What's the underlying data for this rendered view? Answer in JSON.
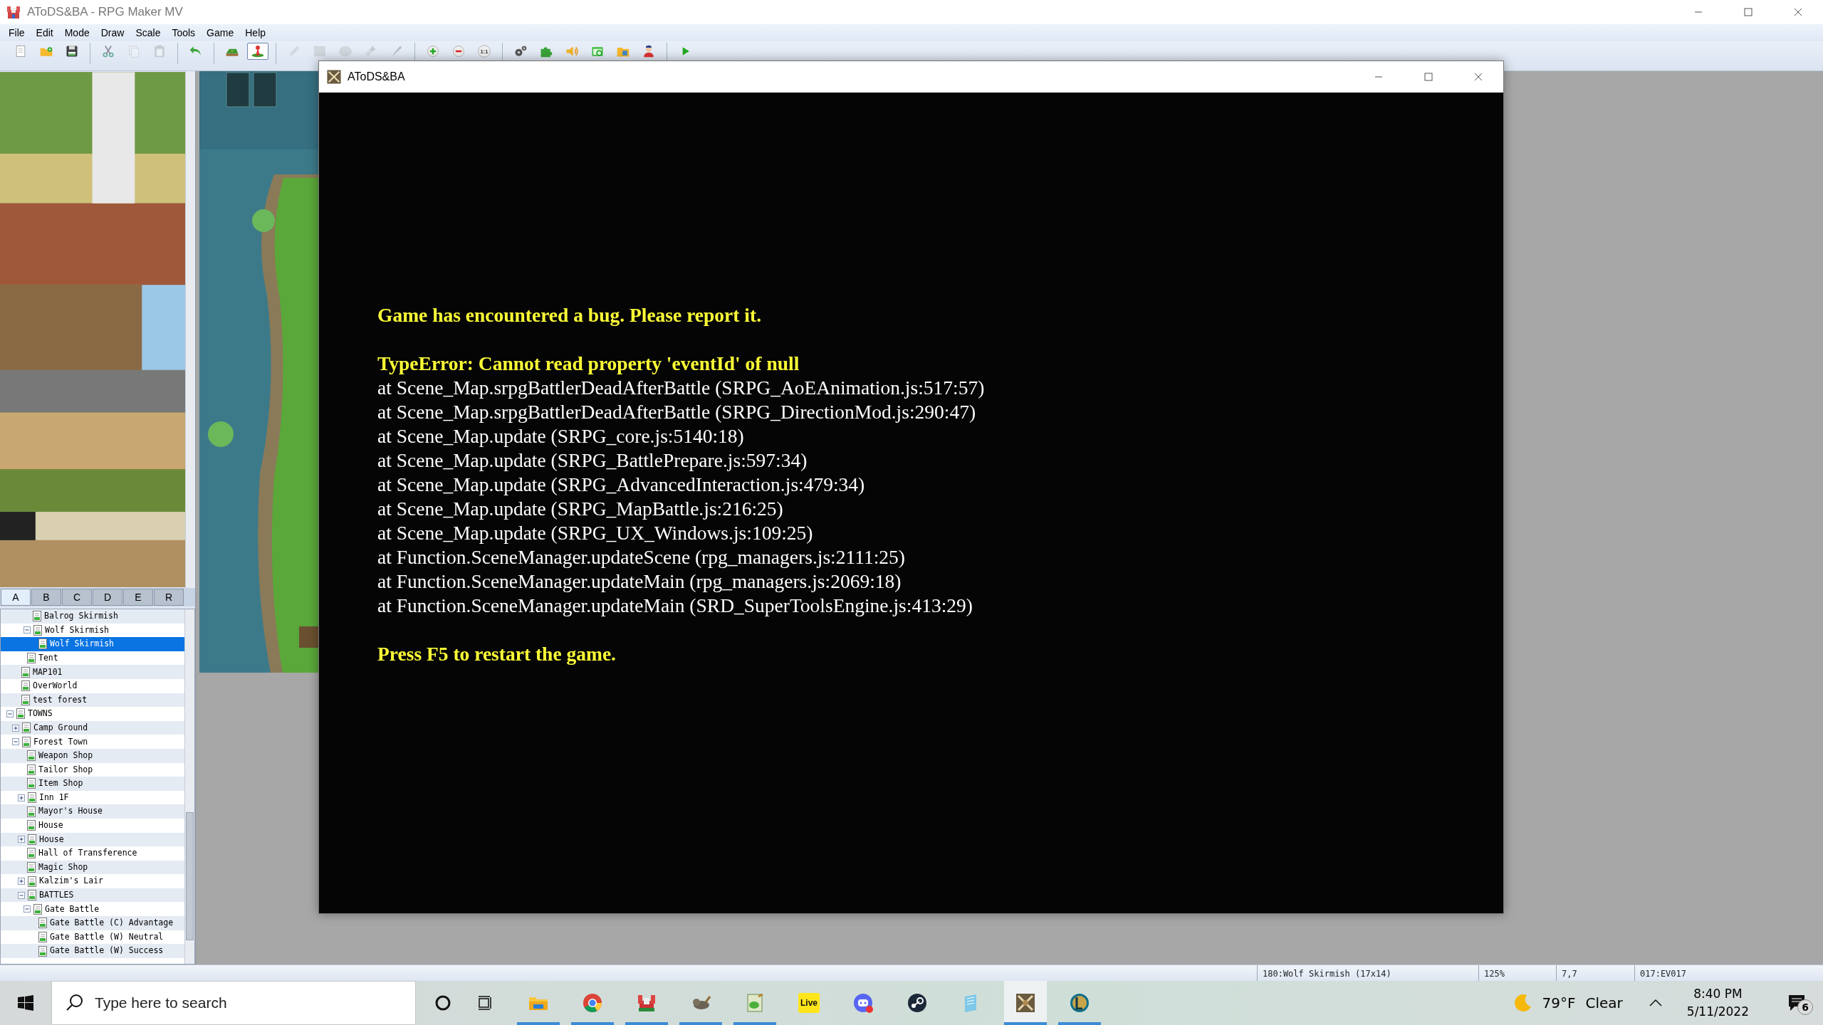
{
  "window": {
    "title": "AToDS&BA - RPG Maker MV"
  },
  "menu": [
    "File",
    "Edit",
    "Mode",
    "Draw",
    "Scale",
    "Tools",
    "Game",
    "Help"
  ],
  "toolbar": [
    {
      "kind": "new",
      "selected": false,
      "disabled": false
    },
    {
      "kind": "open",
      "selected": false,
      "disabled": false
    },
    {
      "kind": "save",
      "selected": false,
      "disabled": false
    },
    {
      "kind": "cut",
      "selected": false,
      "disabled": false
    },
    {
      "kind": "copy",
      "selected": false,
      "disabled": true
    },
    {
      "kind": "paste",
      "selected": false,
      "disabled": true
    },
    {
      "kind": "undo",
      "selected": false,
      "disabled": false
    },
    {
      "kind": "map",
      "selected": false,
      "disabled": false
    },
    {
      "kind": "event",
      "selected": true,
      "disabled": false
    },
    {
      "kind": "pencil",
      "selected": false,
      "disabled": true
    },
    {
      "kind": "rectangle",
      "selected": false,
      "disabled": true
    },
    {
      "kind": "ellipse",
      "selected": false,
      "disabled": true
    },
    {
      "kind": "fill",
      "selected": false,
      "disabled": true
    },
    {
      "kind": "shadow",
      "selected": false,
      "disabled": true
    },
    {
      "kind": "zoom-in",
      "selected": false,
      "disabled": false
    },
    {
      "kind": "zoom-out",
      "selected": false,
      "disabled": false
    },
    {
      "kind": "zoom-reset",
      "label": "1:1",
      "selected": false,
      "disabled": false
    },
    {
      "kind": "database",
      "selected": false,
      "disabled": false
    },
    {
      "kind": "plugins",
      "selected": false,
      "disabled": false
    },
    {
      "kind": "sound",
      "selected": false,
      "disabled": false
    },
    {
      "kind": "search",
      "selected": false,
      "disabled": false
    },
    {
      "kind": "resources",
      "selected": false,
      "disabled": false
    },
    {
      "kind": "generator",
      "selected": false,
      "disabled": false
    },
    {
      "kind": "playtest",
      "selected": false,
      "disabled": false
    }
  ],
  "tile_tabs": [
    {
      "label": "A",
      "selected": true
    },
    {
      "label": "B",
      "selected": false
    },
    {
      "label": "C",
      "selected": false
    },
    {
      "label": "D",
      "selected": false
    },
    {
      "label": "E",
      "selected": false
    },
    {
      "label": "R",
      "selected": false
    }
  ],
  "map_tree": {
    "items": [
      {
        "children": [
          {
            "children": [
              {
                "children": [
                  {
                    "children": [
                      {
                        "label": "Balrog Skirmish",
                        "selected": false
                      },
                      {
                        "label": "Wolf Skirmish",
                        "selected": false,
                        "expanded": true,
                        "children": [
                          {
                            "label": "Wolf Skirmish",
                            "selected": true
                          }
                        ]
                      }
                    ]
                  },
                  {
                    "label": "Tent",
                    "selected": false
                  }
                ]
              },
              {
                "label": "MAP101",
                "selected": false
              },
              {
                "label": "OverWorld",
                "selected": false
              },
              {
                "label": "test forest",
                "selected": false
              }
            ]
          },
          {
            "label": "TOWNS",
            "selected": false,
            "expanded": true,
            "children": [
              {
                "label": "Camp Ground",
                "selected": false,
                "expanded": false
              },
              {
                "label": "Forest Town",
                "selected": false,
                "expanded": true,
                "children": [
                  {
                    "label": "Weapon Shop",
                    "selected": false
                  },
                  {
                    "label": "Tailor Shop",
                    "selected": false
                  },
                  {
                    "label": "Item Shop",
                    "selected": false
                  },
                  {
                    "label": "Inn 1F",
                    "selected": false,
                    "expanded": false
                  },
                  {
                    "label": "Mayor's House",
                    "selected": false
                  },
                  {
                    "label": "House",
                    "selected": false
                  },
                  {
                    "label": "House",
                    "selected": false,
                    "expanded": false
                  },
                  {
                    "label": "Hall of Transference",
                    "selected": false
                  },
                  {
                    "label": "Magic Shop",
                    "selected": false
                  },
                  {
                    "label": "Kalzim's Lair",
                    "selected": false,
                    "expanded": false
                  },
                  {
                    "label": "BATTLES",
                    "selected": false,
                    "expanded": true,
                    "children": [
                      {
                        "label": "Gate Battle",
                        "selected": false,
                        "expanded": true,
                        "children": [
                          {
                            "label": "Gate Battle (C) Advantage",
                            "selected": false
                          },
                          {
                            "label": "Gate Battle (W) Neutral",
                            "selected": false
                          },
                          {
                            "label": "Gate Battle (W) Success",
                            "selected": false
                          }
                        ]
                      }
                    ]
                  }
                ]
              }
            ]
          }
        ]
      }
    ]
  },
  "game_window": {
    "title": "AToDS&BA",
    "blocks": [
      {
        "lines": [
          {
            "kind": "notice",
            "text": "Game has encountered a bug. Please report it."
          }
        ]
      },
      {
        "lines": [
          {
            "kind": "notice",
            "text": "TypeError: Cannot read property 'eventId' of null"
          },
          {
            "kind": "trace",
            "text": "at Scene_Map.srpgBattlerDeadAfterBattle (SRPG_AoEAnimation.js:517:57)"
          },
          {
            "kind": "trace",
            "text": "at Scene_Map.srpgBattlerDeadAfterBattle (SRPG_DirectionMod.js:290:47)"
          },
          {
            "kind": "trace",
            "text": "at Scene_Map.update (SRPG_core.js:5140:18)"
          },
          {
            "kind": "trace",
            "text": "at Scene_Map.update (SRPG_BattlePrepare.js:597:34)"
          },
          {
            "kind": "trace",
            "text": "at Scene_Map.update (SRPG_AdvancedInteraction.js:479:34)"
          },
          {
            "kind": "trace",
            "text": "at Scene_Map.update (SRPG_MapBattle.js:216:25)"
          },
          {
            "kind": "trace",
            "text": "at Scene_Map.update (SRPG_UX_Windows.js:109:25)"
          },
          {
            "kind": "trace",
            "text": "at Function.SceneManager.updateScene (rpg_managers.js:2111:25)"
          },
          {
            "kind": "trace",
            "text": "at Function.SceneManager.updateMain (rpg_managers.js:2069:18)"
          },
          {
            "kind": "trace",
            "text": "at Function.SceneManager.updateMain (SRD_SuperToolsEngine.js:413:29)"
          }
        ]
      },
      {
        "lines": [
          {
            "kind": "notice",
            "text": "Press F5 to restart the game."
          }
        ]
      }
    ]
  },
  "status_bar": [
    "180:Wolf Skirmish (17x14)",
    "125%",
    "7,7",
    "017:EV017"
  ],
  "taskbar": {
    "search": {
      "placeholder": "Type here to search"
    },
    "apps": [
      {
        "kind": "explorer",
        "running": true,
        "active": false
      },
      {
        "kind": "chrome",
        "running": true,
        "active": false
      },
      {
        "kind": "rpgmaker",
        "running": true,
        "active": false
      },
      {
        "kind": "gimp",
        "running": true,
        "active": false
      },
      {
        "kind": "editor",
        "running": true,
        "active": false
      },
      {
        "kind": "live",
        "label": "Live",
        "running": false,
        "active": false
      },
      {
        "kind": "discord",
        "running": false,
        "active": false
      },
      {
        "kind": "steam",
        "running": false,
        "active": false
      },
      {
        "kind": "notepad",
        "running": false,
        "active": false
      },
      {
        "kind": "game",
        "running": true,
        "active": true
      },
      {
        "kind": "league",
        "running": true,
        "active": false
      }
    ],
    "tray": {
      "temperature": "79°F",
      "weather": "Clear",
      "time": "8:40 PM",
      "date": "5/11/2022",
      "notifications": "6"
    }
  }
}
